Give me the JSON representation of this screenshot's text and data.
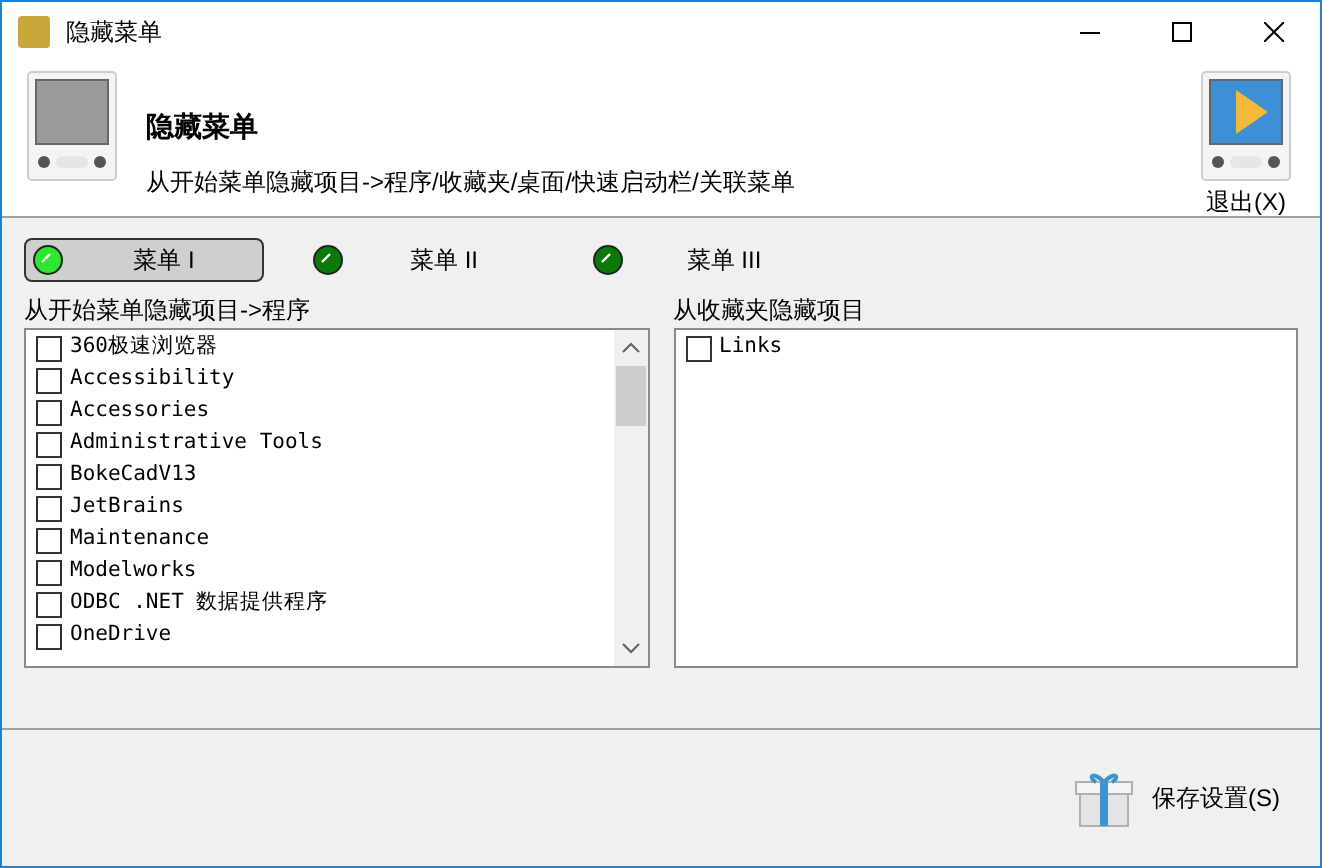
{
  "window": {
    "title": "隐藏菜单"
  },
  "header": {
    "title": "隐藏菜单",
    "subtitle": "从开始菜单隐藏项目->程序/收藏夹/桌面/快速启动栏/关联菜单",
    "exit_label": "退出(X)"
  },
  "tabs": [
    {
      "label": "菜单 I",
      "selected": true
    },
    {
      "label": "菜单 II",
      "selected": false
    },
    {
      "label": "菜单 III",
      "selected": false
    }
  ],
  "left_list": {
    "label": "从开始菜单隐藏项目->程序",
    "items": [
      {
        "label": "360极速浏览器",
        "checked": false
      },
      {
        "label": "Accessibility",
        "checked": false
      },
      {
        "label": "Accessories",
        "checked": false
      },
      {
        "label": "Administrative Tools",
        "checked": false
      },
      {
        "label": "BokeCadV13",
        "checked": false
      },
      {
        "label": "JetBrains",
        "checked": false
      },
      {
        "label": "Maintenance",
        "checked": false
      },
      {
        "label": "Modelworks",
        "checked": false
      },
      {
        "label": "ODBC .NET 数据提供程序",
        "checked": false
      },
      {
        "label": "OneDrive",
        "checked": false
      }
    ]
  },
  "right_list": {
    "label": "从收藏夹隐藏项目",
    "items": [
      {
        "label": "Links",
        "checked": false
      }
    ]
  },
  "footer": {
    "save_label": "保存设置(S)"
  }
}
